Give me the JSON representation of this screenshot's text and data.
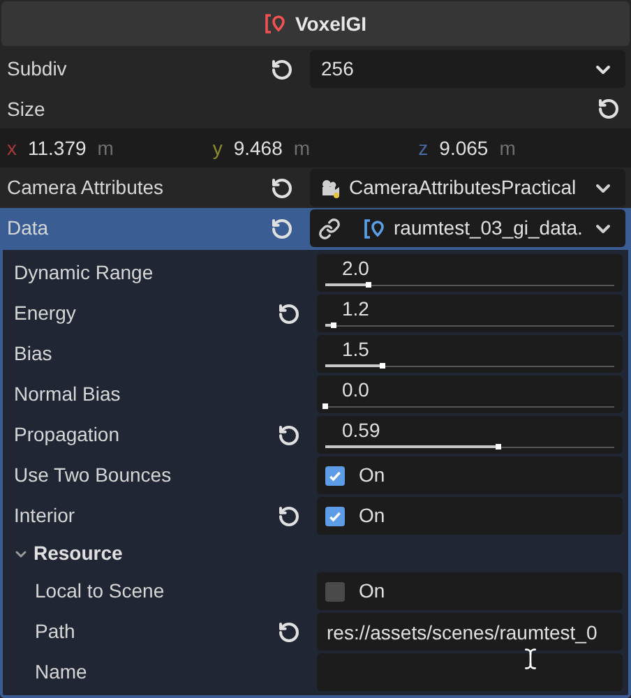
{
  "title": "VoxelGI",
  "properties": [
    {
      "kind": "dropdown",
      "label": "Subdiv",
      "revertible": true,
      "value": "256"
    },
    {
      "kind": "vector",
      "label": "Size",
      "revertible": true,
      "components": [
        {
          "axis": "x",
          "value": "11.379",
          "unit": "m",
          "color": "#a83a3a"
        },
        {
          "axis": "y",
          "value": "9.468",
          "unit": "m",
          "color": "#8c8c2e"
        },
        {
          "axis": "z",
          "value": "9.065",
          "unit": "m",
          "color": "#4a6aa8"
        }
      ]
    },
    {
      "kind": "resource",
      "label": "Camera Attributes",
      "revertible": true,
      "value": "CameraAttributesPractical",
      "linked": false,
      "selected": false
    },
    {
      "kind": "resource",
      "label": "Data",
      "revertible": true,
      "value": "raumtest_03_gi_data.",
      "linked": true,
      "selected": true
    }
  ],
  "data_properties": [
    {
      "kind": "slider",
      "label": "Dynamic Range",
      "revertible": false,
      "value": "2.0",
      "level": 0.15
    },
    {
      "kind": "slider",
      "label": "Energy",
      "revertible": true,
      "value": "1.2",
      "level": 0.03
    },
    {
      "kind": "slider",
      "label": "Bias",
      "revertible": false,
      "value": "1.5",
      "level": 0.2
    },
    {
      "kind": "slider",
      "label": "Normal Bias",
      "revertible": false,
      "value": "0.0",
      "level": 0
    },
    {
      "kind": "slider",
      "label": "Propagation",
      "revertible": true,
      "value": "0.59",
      "level": 0.6
    },
    {
      "kind": "checkbox",
      "label": "Use Two Bounces",
      "revertible": false,
      "value": "On",
      "checked": true
    },
    {
      "kind": "checkbox",
      "label": "Interior",
      "revertible": true,
      "value": "On",
      "checked": true
    },
    {
      "kind": "section",
      "label": "Resource",
      "expanded": true,
      "children": [
        {
          "kind": "checkbox",
          "label": "Local to Scene",
          "revertible": false,
          "value": "On",
          "checked": false
        },
        {
          "kind": "text",
          "label": "Path",
          "revertible": true,
          "value": "res://assets/scenes/raumtest_0"
        },
        {
          "kind": "text",
          "label": "Name",
          "revertible": false,
          "cursor": true
        }
      ]
    }
  ]
}
